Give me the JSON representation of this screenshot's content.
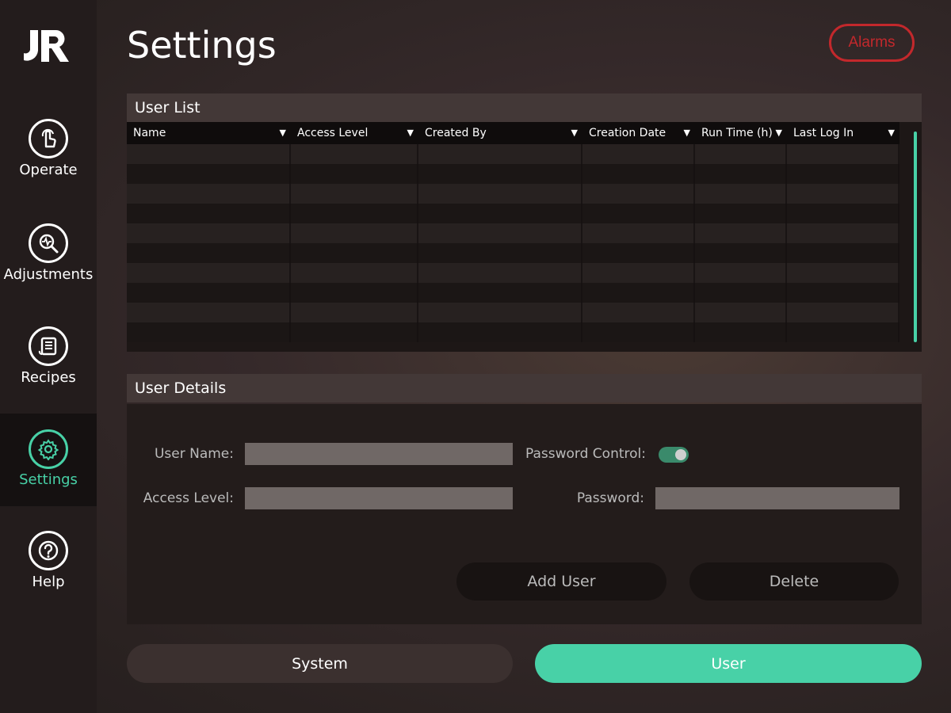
{
  "app": {
    "logo_text": "JR"
  },
  "page": {
    "title": "Settings"
  },
  "header": {
    "alarms_label": "Alarms"
  },
  "colors": {
    "accent": "#48d1a7",
    "alarm": "#c3282c"
  },
  "sidebar": {
    "items": [
      {
        "label": "Operate",
        "icon": "hand-pointer-icon",
        "active": false
      },
      {
        "label": "Adjustments",
        "icon": "magnifier-pulse-icon",
        "active": false
      },
      {
        "label": "Recipes",
        "icon": "document-list-icon",
        "active": false
      },
      {
        "label": "Settings",
        "icon": "gear-icon",
        "active": true
      },
      {
        "label": "Help",
        "icon": "question-icon",
        "active": false
      }
    ]
  },
  "user_list": {
    "title": "User List",
    "columns": [
      "Name",
      "Access Level",
      "Created By",
      "Creation Date",
      "Run Time (h)",
      "Last Log In"
    ],
    "rows": [
      [
        "",
        "",
        "",
        "",
        "",
        ""
      ],
      [
        "",
        "",
        "",
        "",
        "",
        ""
      ],
      [
        "",
        "",
        "",
        "",
        "",
        ""
      ],
      [
        "",
        "",
        "",
        "",
        "",
        ""
      ],
      [
        "",
        "",
        "",
        "",
        "",
        ""
      ],
      [
        "",
        "",
        "",
        "",
        "",
        ""
      ],
      [
        "",
        "",
        "",
        "",
        "",
        ""
      ],
      [
        "",
        "",
        "",
        "",
        "",
        ""
      ],
      [
        "",
        "",
        "",
        "",
        "",
        ""
      ],
      [
        "",
        "",
        "",
        "",
        "",
        ""
      ]
    ]
  },
  "user_details": {
    "title": "User Details",
    "user_name_label": "User Name:",
    "user_name_value": "",
    "access_level_label": "Access Level:",
    "access_level_value": "",
    "password_control_label": "Password Control:",
    "password_control_on": true,
    "password_label": "Password:",
    "password_value": "",
    "add_user_label": "Add User",
    "delete_label": "Delete"
  },
  "tabs": {
    "system_label": "System",
    "user_label": "User",
    "active": "User"
  }
}
